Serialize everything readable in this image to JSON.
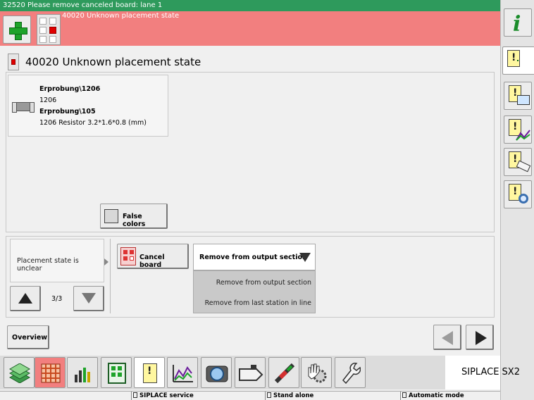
{
  "topbar": {
    "message": "32520 Please remove canceled board: lane 1"
  },
  "msgbar": {
    "message": "40020 Unknown placement state"
  },
  "title": "40020 Unknown placement state",
  "component": {
    "line1": "Erprobung\\1206",
    "line2": "1206",
    "line3": "Erprobung\\105",
    "line4": "1206 Resistor  3.2*1.6*0.8 (mm)"
  },
  "false_colors_label": "False colors",
  "state_text": "Placement state is unclear",
  "pager": "3/3",
  "cancel_board_label": "Cancel board",
  "dropdown": {
    "selected": "Remove from output section",
    "options": [
      "Remove from output section",
      "Remove from last station in line"
    ]
  },
  "overview_label": "Overview",
  "brand": "SIPLACE SX2",
  "statusbar": {
    "seg1": "SIPLACE service",
    "seg2": "Stand alone",
    "seg3": "Automatic mode"
  },
  "toolbar_icons": [
    "stack-icon",
    "grid-icon",
    "bar-chart-icon",
    "board-icon",
    "alert-icon",
    "trend-icon",
    "camera-icon",
    "feeder-icon",
    "nozzle-icon",
    "hand-gear-icon",
    "wrench-icon"
  ],
  "sidebar_icons": [
    "info-icon",
    "alert-add-icon",
    "alert-monitor-icon",
    "alert-chart-icon",
    "alert-feeder-icon",
    "alert-search-icon"
  ],
  "colors": {
    "topbar": "#2e9a5c",
    "alert": "#f27f7f",
    "accent_green": "#1ea32a"
  }
}
